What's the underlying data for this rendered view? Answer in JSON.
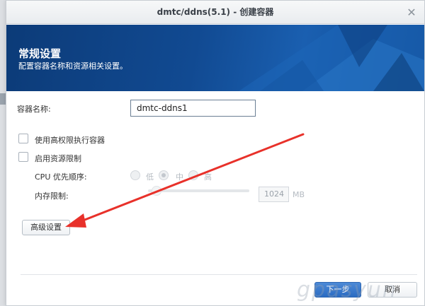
{
  "window": {
    "title": "dmtc/ddns(5.1) - 创建容器",
    "close_glyph": "✕"
  },
  "banner": {
    "title": "常规设置",
    "subtitle": "配置容器名称和资源相关设置。"
  },
  "form": {
    "container_name_label": "容器名称:",
    "container_name_value": "dmtc-ddns1",
    "privileged_label": "使用高权限执行容器",
    "resource_limit_label": "启用资源限制",
    "cpu_priority_label": "CPU 优先顺序:",
    "cpu_options": [
      "低",
      "中",
      "高"
    ],
    "cpu_selected": "中",
    "memory_limit_label": "内存限制:",
    "memory_value": "1024",
    "memory_unit": "MB"
  },
  "buttons": {
    "advanced": "高级设置",
    "next": "下一步",
    "cancel": "取消"
  },
  "watermark": "gpasyun",
  "colors": {
    "banner": "#114a92",
    "primary_button": "#2a6bc2",
    "annotation_arrow": "#e8312a"
  }
}
